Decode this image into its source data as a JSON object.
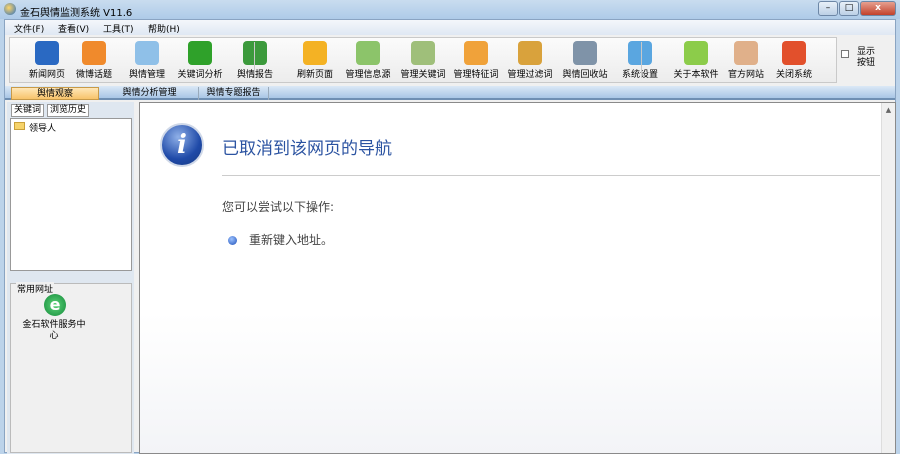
{
  "window": {
    "title": "金石舆情监测系统 V11.6",
    "minimize": "–",
    "maximize": "□",
    "close": "x"
  },
  "menu": [
    "文件(F)",
    "查看(V)",
    "工具(T)",
    "帮助(H)"
  ],
  "toolbar": [
    {
      "label": "新闻网页",
      "icon": "news-icon",
      "color": "#2a69c2"
    },
    {
      "label": "微博话题",
      "icon": "rss-icon",
      "color": "#f08a2c"
    },
    {
      "label": "舆情管理",
      "icon": "document-icon",
      "color": "#8fc0e8"
    },
    {
      "label": "关键词分析",
      "icon": "bar-chart-icon",
      "color": "#2fa12a"
    },
    {
      "label": "舆情报告",
      "icon": "excel-icon",
      "color": "#3c9a3c"
    },
    {
      "label": "刷新页面",
      "icon": "star-icon",
      "color": "#f4b224"
    },
    {
      "label": "管理信息源",
      "icon": "cabinet-icon",
      "color": "#8cc46a"
    },
    {
      "label": "管理关键词",
      "icon": "table-icon",
      "color": "#9fbf7a"
    },
    {
      "label": "管理特征词",
      "icon": "card-icon",
      "color": "#f0a23a"
    },
    {
      "label": "管理过滤词",
      "icon": "folder-icon",
      "color": "#d9a23c"
    },
    {
      "label": "舆情回收站",
      "icon": "recycle-bin-icon",
      "color": "#7f93a8"
    },
    {
      "label": "系统设置",
      "icon": "monitor-icon",
      "color": "#5aa6e0"
    },
    {
      "label": "关于本软件",
      "icon": "chat-bubble-icon",
      "color": "#8ccc4a"
    },
    {
      "label": "官方网站",
      "icon": "home-icon",
      "color": "#e0b08a"
    },
    {
      "label": "关闭系统",
      "icon": "close-circle-icon",
      "color": "#e2502c"
    }
  ],
  "show_buttons_label": "显示按钮",
  "tabs": [
    "舆情观察",
    "舆情分析管理",
    "舆情专题报告"
  ],
  "left": {
    "tabs": [
      "关键词",
      "浏览历史"
    ],
    "tree": [
      "领导人"
    ],
    "sites_title": "常用网址",
    "sites": [
      "金石软件服务中心"
    ]
  },
  "page": {
    "title": "已取消到该网页的导航",
    "subtitle": "您可以尝试以下操作:",
    "items": [
      "重新键入地址。"
    ]
  }
}
